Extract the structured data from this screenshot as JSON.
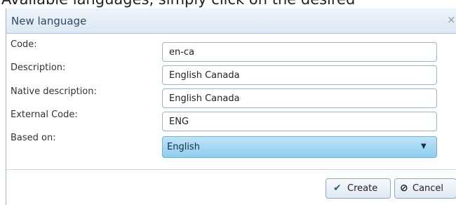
{
  "background_text": "Available languages, simply click on the desired",
  "dialog": {
    "title": "New language",
    "close_glyph": "×"
  },
  "form": {
    "code": {
      "label": "Code:",
      "value": "en-ca"
    },
    "description": {
      "label": "Description:",
      "value": "English Canada"
    },
    "native_description": {
      "label": "Native description:",
      "value": "English Canada"
    },
    "external_code": {
      "label": "External Code:",
      "value": "ENG"
    },
    "based_on": {
      "label": "Based on:",
      "value": "English"
    }
  },
  "buttons": {
    "create": {
      "label": "Create",
      "icon": "checkmark-icon",
      "glyph": "✔"
    },
    "cancel": {
      "label": "Cancel",
      "icon": "cancel-icon",
      "glyph": "⊘"
    }
  },
  "colors": {
    "title_text": "#2d4a66",
    "select_gradient_top": "#bfe4f7",
    "select_gradient_bottom": "#8dcdf0"
  }
}
